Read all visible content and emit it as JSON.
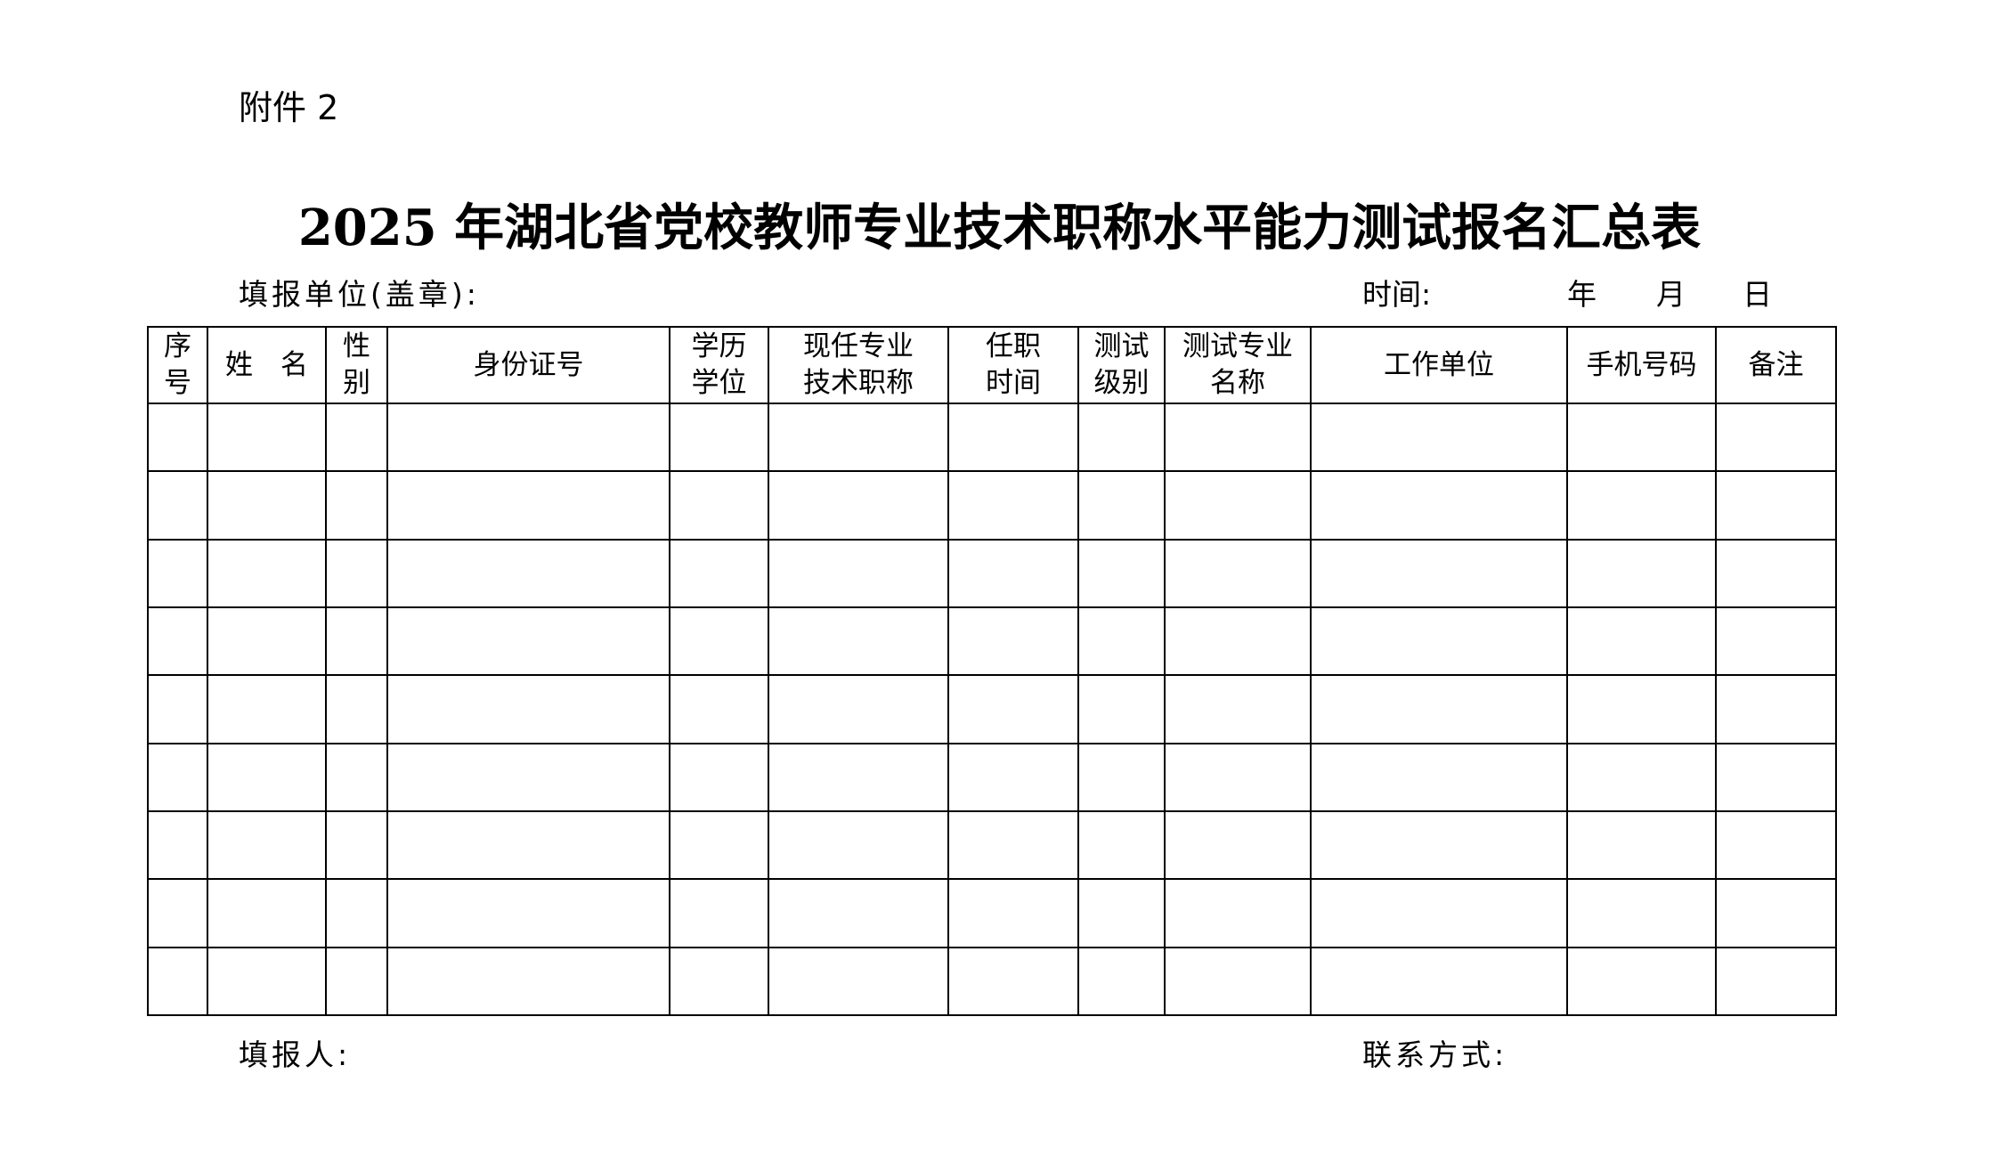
{
  "attachment_label": "附件 2",
  "title": "2025 年湖北省党校教师专业技术职称水平能力测试报名汇总表",
  "form_meta": {
    "unit_label": "填报单位(盖章):",
    "time_label": "时间:",
    "year_label": "年",
    "month_label": "月",
    "day_label": "日"
  },
  "table": {
    "headers": [
      {
        "line1": "序",
        "line2": "号"
      },
      {
        "line1": "姓　名",
        "line2": ""
      },
      {
        "line1": "性",
        "line2": "别"
      },
      {
        "line1": "身份证号",
        "line2": ""
      },
      {
        "line1": "学历",
        "line2": "学位"
      },
      {
        "line1": "现任专业",
        "line2": "技术职称"
      },
      {
        "line1": "任职",
        "line2": "时间"
      },
      {
        "line1": "测试",
        "line2": "级别"
      },
      {
        "line1": "测试专业",
        "line2": "名称"
      },
      {
        "line1": "工作单位",
        "line2": ""
      },
      {
        "line1": "手机号码",
        "line2": ""
      },
      {
        "line1": "备注",
        "line2": ""
      }
    ],
    "empty_row_count": 9
  },
  "footer": {
    "filler_label": "填报人:",
    "contact_label": "联系方式:"
  }
}
